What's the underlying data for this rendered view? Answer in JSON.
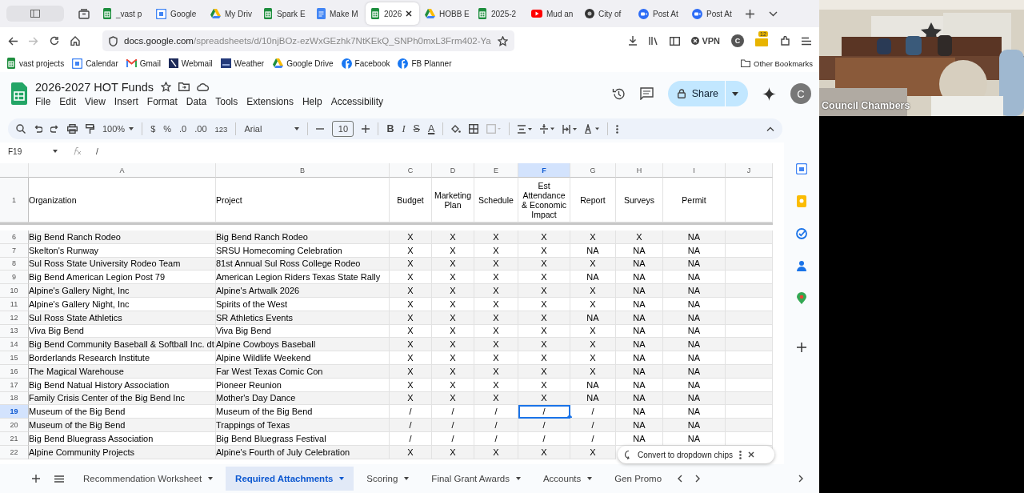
{
  "browser": {
    "tabs": [
      {
        "label": "_vast p",
        "kind": "sheets",
        "selected": false
      },
      {
        "label": "Google",
        "kind": "calendar",
        "selected": false
      },
      {
        "label": "My Driv",
        "kind": "drive",
        "selected": false
      },
      {
        "label": "Spark E",
        "kind": "sheets",
        "selected": false
      },
      {
        "label": "Make M",
        "kind": "docs",
        "selected": false
      },
      {
        "label": "2026",
        "kind": "sheets",
        "selected": true
      },
      {
        "label": "HOBB E",
        "kind": "drive",
        "selected": false
      },
      {
        "label": "2025-2",
        "kind": "sheets",
        "selected": false
      },
      {
        "label": "Mud an",
        "kind": "youtube",
        "selected": false
      },
      {
        "label": "City of",
        "kind": "circle",
        "selected": false
      },
      {
        "label": "Post At",
        "kind": "zoom",
        "selected": false
      },
      {
        "label": "Post At",
        "kind": "zoom",
        "selected": false
      }
    ],
    "address": {
      "host": "docs.google.com",
      "path": "/spreadsheets/d/10njBOz-ezWxGEzhk7NtKEkQ_SNPh0mxL3Frm402-Ya"
    },
    "vpn": "VPN",
    "avatar": "C",
    "downloads_badge": "12",
    "bookmarks": [
      {
        "label": "vast projects",
        "kind": "sheets"
      },
      {
        "label": "Calendar",
        "kind": "calendar"
      },
      {
        "label": "Gmail",
        "kind": "gmail"
      },
      {
        "label": "Webmail",
        "kind": "webmail"
      },
      {
        "label": "Weather",
        "kind": "weather"
      },
      {
        "label": "Google Drive",
        "kind": "drive"
      },
      {
        "label": "Facebook",
        "kind": "facebook"
      },
      {
        "label": "FB Planner",
        "kind": "facebook"
      }
    ],
    "other_bookmarks": "Other Bookmarks"
  },
  "sheet": {
    "title": "2026-2027 HOT Funds",
    "menus": [
      "File",
      "Edit",
      "View",
      "Insert",
      "Format",
      "Data",
      "Tools",
      "Extensions",
      "Help",
      "Accessibility"
    ],
    "share": "Share",
    "avatar": "C",
    "zoom": "100%",
    "number_formats": [
      "$",
      "%",
      ".0",
      ".00",
      "123"
    ],
    "font": "Arial",
    "font_size": "10",
    "format_buttons": [
      {
        "label": "B",
        "kind": "bold"
      },
      {
        "label": "I",
        "kind": "italic"
      },
      {
        "label": "S",
        "kind": "strike"
      },
      {
        "label": "A",
        "kind": "color"
      }
    ],
    "name_box": "F19",
    "formula": "/",
    "columns": [
      {
        "letter": "A",
        "selected": false
      },
      {
        "letter": "B",
        "selected": false
      },
      {
        "letter": "C",
        "selected": false
      },
      {
        "letter": "D",
        "selected": false
      },
      {
        "letter": "E",
        "selected": false
      },
      {
        "letter": "F",
        "selected": true
      },
      {
        "letter": "G",
        "selected": false
      },
      {
        "letter": "H",
        "selected": false
      },
      {
        "letter": "I",
        "selected": false
      },
      {
        "letter": "J",
        "selected": false
      }
    ],
    "header": {
      "number": "1",
      "cells": [
        "Organization",
        "Project",
        "Budget",
        "Marketing Plan",
        "Schedule",
        "Est Attendance & Economic Impact",
        "Report",
        "Surveys",
        "Permit"
      ]
    },
    "rows": [
      {
        "number": "6",
        "selected": false,
        "cells": [
          "Big Bend Ranch Rodeo",
          "Big Bend Ranch Rodeo",
          "X",
          "X",
          "X",
          "X",
          "X",
          "X",
          "NA"
        ]
      },
      {
        "number": "7",
        "selected": false,
        "cells": [
          "Skelton's Runway",
          "SRSU Homecoming Celebration",
          "X",
          "X",
          "X",
          "X",
          "NA",
          "NA",
          "NA"
        ]
      },
      {
        "number": "8",
        "selected": false,
        "cells": [
          "Sul Ross State University Rodeo Team",
          "81st Annual Sul Ross College Rodeo",
          "X",
          "X",
          "X",
          "X",
          "X",
          "NA",
          "NA"
        ]
      },
      {
        "number": "9",
        "selected": false,
        "cells": [
          "Big Bend American Legion Post 79",
          "American Legion Riders Texas State Rally",
          "X",
          "X",
          "X",
          "X",
          "NA",
          "NA",
          "NA"
        ]
      },
      {
        "number": "10",
        "selected": false,
        "cells": [
          "Alpine's Gallery Night, Inc",
          "Alpine's Artwalk 2026",
          "X",
          "X",
          "X",
          "X",
          "X",
          "NA",
          "NA"
        ]
      },
      {
        "number": "11",
        "selected": false,
        "cells": [
          "Alpine's Gallery Night, Inc",
          "Spirits of the West",
          "X",
          "X",
          "X",
          "X",
          "X",
          "NA",
          "NA"
        ]
      },
      {
        "number": "12",
        "selected": false,
        "cells": [
          "Sul Ross State Athletics",
          "SR Athletics Events",
          "X",
          "X",
          "X",
          "X",
          "NA",
          "NA",
          "NA"
        ]
      },
      {
        "number": "13",
        "selected": false,
        "cells": [
          "Viva Big Bend",
          "Viva Big Bend",
          "X",
          "X",
          "X",
          "X",
          "X",
          "NA",
          "NA"
        ]
      },
      {
        "number": "14",
        "selected": false,
        "cells": [
          "Big Bend Community Baseball & Softball Inc. dt",
          "Alpine Cowboys Baseball",
          "X",
          "X",
          "X",
          "X",
          "X",
          "NA",
          "NA"
        ]
      },
      {
        "number": "15",
        "selected": false,
        "cells": [
          "Borderlands Research Institute",
          "Alpine Wildlife Weekend",
          "X",
          "X",
          "X",
          "X",
          "X",
          "NA",
          "NA"
        ]
      },
      {
        "number": "16",
        "selected": false,
        "cells": [
          "The Magical Warehouse",
          "Far West Texas Comic Con",
          "X",
          "X",
          "X",
          "X",
          "X",
          "NA",
          "NA"
        ]
      },
      {
        "number": "17",
        "selected": false,
        "cells": [
          "Big Bend Natual History Association",
          "Pioneer Reunion",
          "X",
          "X",
          "X",
          "X",
          "NA",
          "NA",
          "NA"
        ]
      },
      {
        "number": "18",
        "selected": false,
        "cells": [
          "Family Crisis Center of the Big Bend Inc",
          "Mother's Day Dance",
          "X",
          "X",
          "X",
          "X",
          "NA",
          "NA",
          "NA"
        ]
      },
      {
        "number": "19",
        "selected": true,
        "cells": [
          "Museum of the Big Bend",
          "Museum of the Big Bend",
          "/",
          "/",
          "/",
          "/",
          "/",
          "NA",
          "NA"
        ]
      },
      {
        "number": "20",
        "selected": false,
        "cells": [
          "Museum of the Big Bend",
          "Trappings of Texas",
          "/",
          "/",
          "/",
          "/",
          "/",
          "NA",
          "NA"
        ]
      },
      {
        "number": "21",
        "selected": false,
        "cells": [
          "Big Bend Bluegrass Association",
          "Big Bend Bluegrass Festival",
          "/",
          "/",
          "/",
          "/",
          "/",
          "NA",
          "NA"
        ]
      },
      {
        "number": "22",
        "selected": false,
        "cells": [
          "Alpine Community Projects",
          "Alpine's Fourth of July Celebration",
          "X",
          "X",
          "X",
          "X",
          "X"
        ]
      }
    ],
    "toast": "Convert to dropdown chips",
    "sheet_tabs": [
      {
        "label": "Recommendation Worksheet",
        "selected": false
      },
      {
        "label": "Required Attachments",
        "selected": true
      },
      {
        "label": "Scoring",
        "selected": false
      },
      {
        "label": "Final Grant Awards",
        "selected": false
      },
      {
        "label": "Accounts",
        "selected": false
      },
      {
        "label": "Gen Promo",
        "selected": false
      }
    ]
  },
  "video": {
    "caption": "Council Chambers"
  }
}
